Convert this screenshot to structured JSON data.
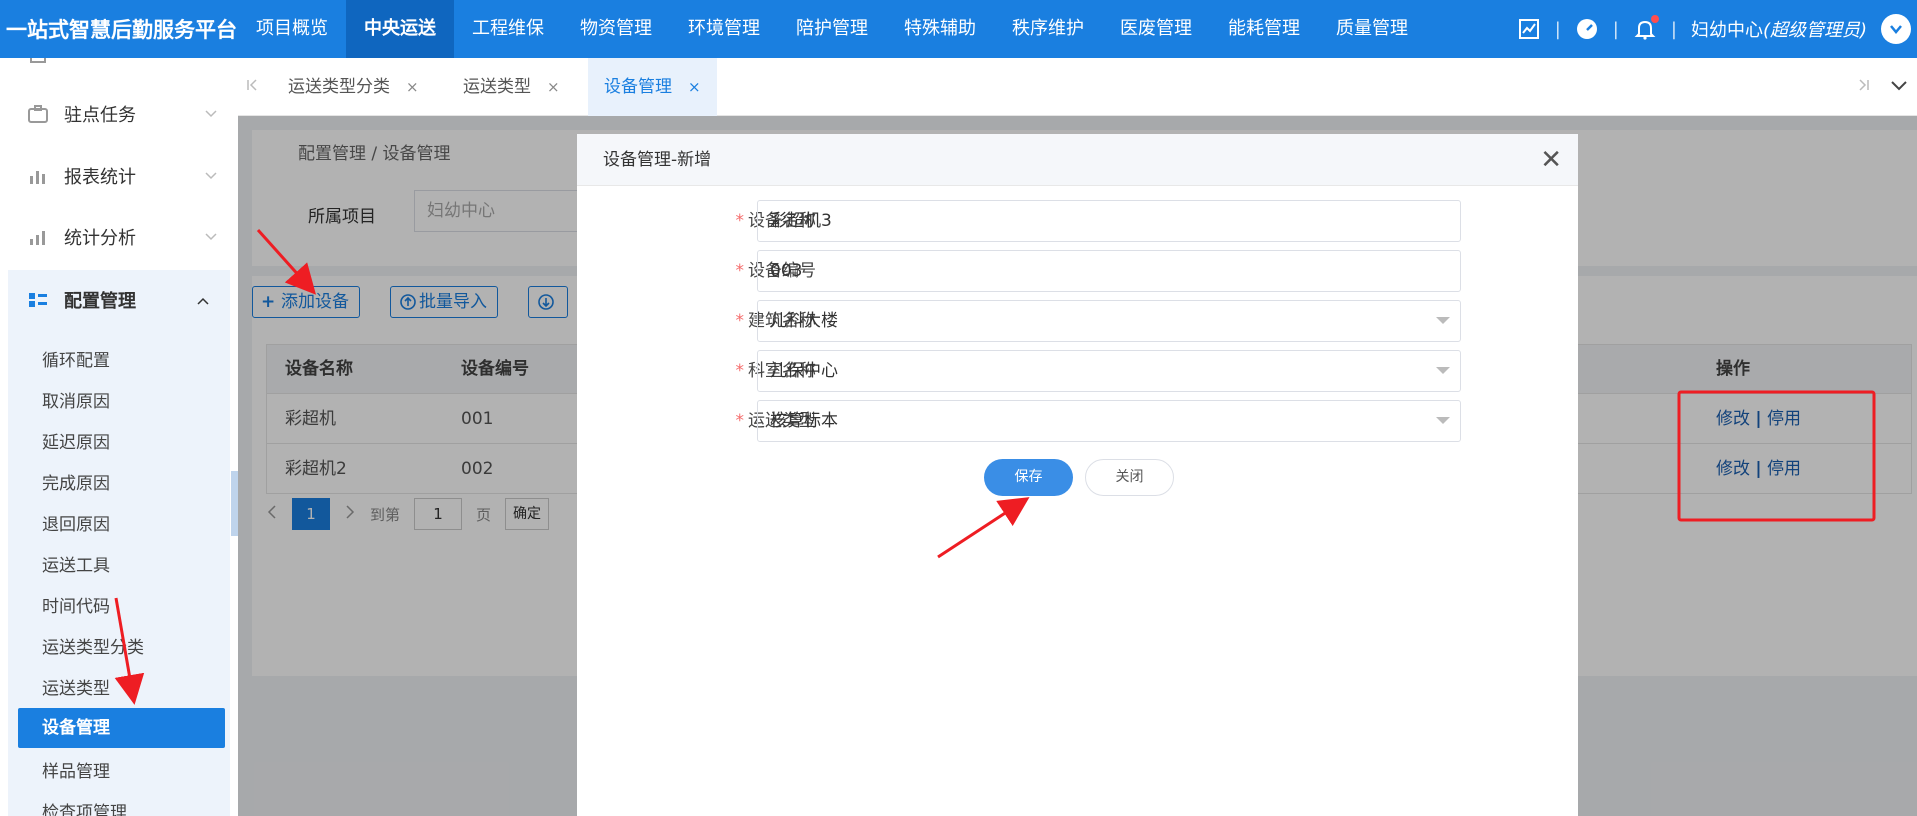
{
  "app": {
    "title": "一站式智慧后勤服务平台",
    "accent_color": "#1a7fe0"
  },
  "top_nav": [
    "项目概览",
    "中央运送",
    "工程维保",
    "物资管理",
    "环境管理",
    "陪护管理",
    "特殊辅助",
    "秩序维护",
    "医废管理",
    "能耗管理",
    "质量管理"
  ],
  "top_nav_active": "中央运送",
  "user": {
    "name": "妇幼中心",
    "role": "(超级管理员)"
  },
  "sidebar": {
    "groups": [
      {
        "label": "驻点任务",
        "icon": "briefcase-icon"
      },
      {
        "label": "报表统计",
        "icon": "bar-chart-icon"
      },
      {
        "label": "统计分析",
        "icon": "analysis-chart-icon"
      },
      {
        "label": "配置管理",
        "icon": "list-settings-icon"
      }
    ],
    "sub_items": [
      "循环配置",
      "取消原因",
      "延迟原因",
      "完成原因",
      "退回原因",
      "运送工具",
      "时间代码",
      "运送类型分类",
      "运送类型",
      "设备管理",
      "样品管理",
      "检查项管理"
    ],
    "active": "设备管理"
  },
  "tabs": [
    {
      "label": "运送类型分类",
      "close": "×"
    },
    {
      "label": "运送类型",
      "close": "×"
    },
    {
      "label": "设备管理",
      "close": "×"
    }
  ],
  "main": {
    "breadcrumb": "配置管理  /  设备管理",
    "filter_label": "所属项目",
    "filter_placeholder": "妇幼中心",
    "buttons": {
      "add": "添加设备",
      "import": "批量导入"
    },
    "table": {
      "headers": [
        "设备名称",
        "设备编号",
        "操作"
      ],
      "rows": [
        {
          "name": "彩超机",
          "code": "001",
          "edit": "修改",
          "sep": "|",
          "disable": "停用"
        },
        {
          "name": "彩超机2",
          "code": "002",
          "edit": "修改",
          "sep": "|",
          "disable": "停用"
        }
      ]
    },
    "pager": {
      "current": "1",
      "goto_prefix": "到第",
      "goto_value": "1",
      "goto_suffix": "页",
      "confirm": "确定"
    }
  },
  "modal": {
    "title": "设备管理-新增",
    "close": "✕",
    "fields": [
      {
        "label": "设备名称",
        "value": "彩超机3",
        "type": "input"
      },
      {
        "label": "设备编号",
        "value": "003",
        "type": "input"
      },
      {
        "label": "建筑名称",
        "value": "儿科大楼",
        "type": "select"
      },
      {
        "label": "科室名称",
        "value": "儿保中心",
        "type": "select"
      },
      {
        "label": "运送类型",
        "value": "核算标本",
        "type": "select"
      }
    ],
    "save": "保存",
    "cancel": "关闭"
  },
  "annotation_color": "#ee1d23"
}
